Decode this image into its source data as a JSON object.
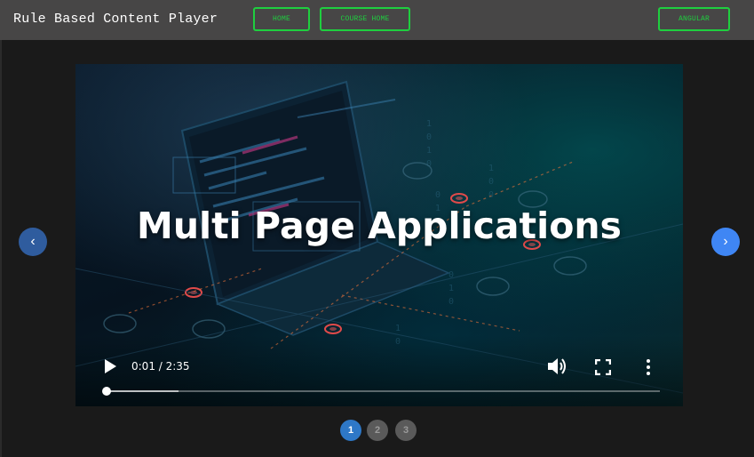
{
  "header": {
    "brand": "Rule Based Content Player",
    "nav": [
      {
        "id": "home",
        "label": "HOME"
      },
      {
        "id": "course",
        "label": "COURSE HOME"
      },
      {
        "id": "angular",
        "label": "ANGULAR"
      }
    ]
  },
  "accent_color": "#1fcf3f",
  "video": {
    "title": "Multi Page Applications",
    "time_display": "0:01 / 2:35",
    "progress_fraction": 0.0065,
    "buffered_fraction": 0.135,
    "icons": {
      "play": "play-icon",
      "volume": "volume-icon",
      "fullscreen": "fullscreen-icon",
      "more": "more-vertical-icon"
    }
  },
  "carousel": {
    "prev_glyph": "‹",
    "next_glyph": "›",
    "pages": [
      "1",
      "2",
      "3"
    ],
    "active_index": 0
  }
}
